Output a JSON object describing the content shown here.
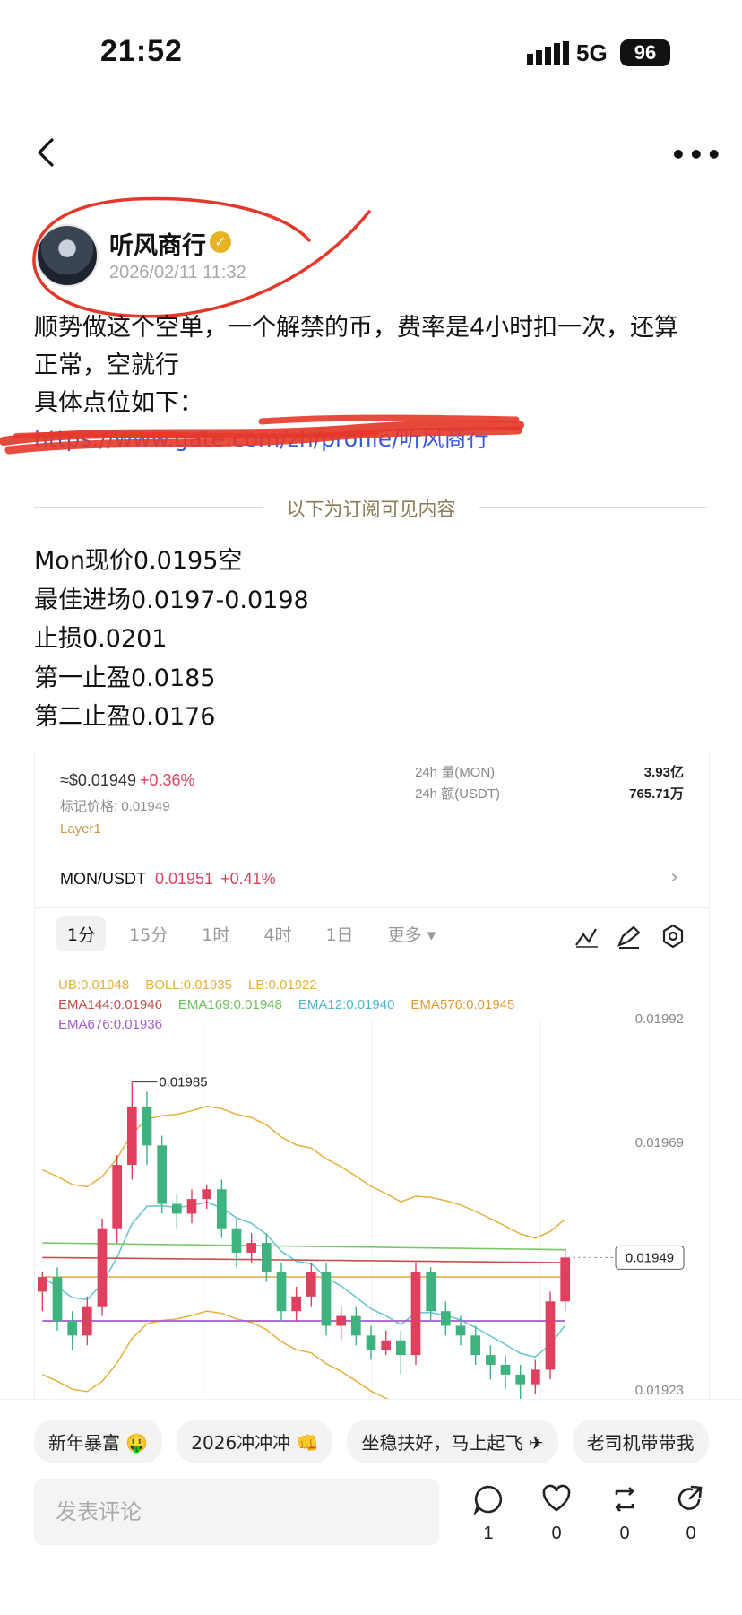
{
  "status_bar": {
    "time": "21:52",
    "network": "5G",
    "battery": "96"
  },
  "post": {
    "author": "听风商行",
    "time": "2026/02/11 11:32",
    "body_lines": [
      "顺势做这个空单，一个解禁的币，费率是4小时扣一次，还算",
      "正常，空就行",
      "具体点位如下："
    ],
    "link": "https://www.gate.com/zh/profile/听风商行",
    "subscriber_divider": "以下为订阅可见内容",
    "plan_lines": [
      "Mon现价0.0195空",
      "最佳进场0.0197-0.0198",
      "止损0.0201",
      "第一止盈0.0185",
      "第二止盈0.0176"
    ]
  },
  "screenshot": {
    "usd_price": "≈$0.01949",
    "usd_change": "+0.36%",
    "mark_price": "标记价格: 0.01949",
    "tag": "Layer1",
    "stats": [
      {
        "label": "24h  量(MON)",
        "value": "3.93亿"
      },
      {
        "label": "24h  额(USDT)",
        "value": "765.71万"
      }
    ],
    "pair": "MON/USDT",
    "pair_price": "0.01951",
    "pair_change": "+0.41%",
    "timeframes": [
      "1分",
      "15分",
      "1时",
      "4时",
      "1日",
      "更多 ▾"
    ],
    "indicators_row1": [
      "UB:0.01948",
      "BOLL:0.01935",
      "LB:0.01922"
    ],
    "indicators_row2": [
      "EMA144:0.01946",
      "EMA169:0.01948",
      "EMA12:0.01940",
      "EMA576:0.01945"
    ],
    "indicators_row3": [
      "EMA676:0.01936"
    ],
    "indicator_colors": [
      "#e7b03a",
      "#e7b03a",
      "#e7b03a",
      "#c0504d",
      "#7ac76a",
      "#6bc6d4",
      "#e09a3a",
      "#a65bd1"
    ],
    "y_labels": [
      "0.01992",
      "0.01969",
      "0.01923"
    ],
    "high_label": "0.01985",
    "current_label": "0.01949"
  },
  "chart_data": {
    "type": "candlestick",
    "ylim": [
      0.0192,
      0.01998
    ],
    "candles": [
      [
        0.01942,
        0.01945,
        0.01938,
        0.01946
      ],
      [
        0.01945,
        0.01936,
        0.01934,
        0.01947
      ],
      [
        0.01936,
        0.01933,
        0.0193,
        0.01938
      ],
      [
        0.01933,
        0.01939,
        0.01931,
        0.01941
      ],
      [
        0.01939,
        0.01955,
        0.01937,
        0.01957
      ],
      [
        0.01955,
        0.01968,
        0.01952,
        0.0197
      ],
      [
        0.01968,
        0.0198,
        0.01965,
        0.01985
      ],
      [
        0.0198,
        0.01972,
        0.01968,
        0.01983
      ],
      [
        0.01972,
        0.0196,
        0.01958,
        0.01974
      ],
      [
        0.0196,
        0.01958,
        0.01955,
        0.01962
      ],
      [
        0.01958,
        0.01961,
        0.01956,
        0.01963
      ],
      [
        0.01961,
        0.01963,
        0.01959,
        0.01964
      ],
      [
        0.01963,
        0.01955,
        0.01953,
        0.01965
      ],
      [
        0.01955,
        0.0195,
        0.01947,
        0.01957
      ],
      [
        0.0195,
        0.01952,
        0.01948,
        0.01954
      ],
      [
        0.01952,
        0.01946,
        0.01944,
        0.01954
      ],
      [
        0.01946,
        0.01938,
        0.01936,
        0.01948
      ],
      [
        0.01938,
        0.01941,
        0.01936,
        0.01943
      ],
      [
        0.01941,
        0.01946,
        0.01939,
        0.01948
      ],
      [
        0.01946,
        0.01935,
        0.01933,
        0.01948
      ],
      [
        0.01935,
        0.01937,
        0.01932,
        0.01939
      ],
      [
        0.01937,
        0.01933,
        0.01931,
        0.01939
      ],
      [
        0.01933,
        0.0193,
        0.01928,
        0.01935
      ],
      [
        0.0193,
        0.01932,
        0.01929,
        0.01934
      ],
      [
        0.01932,
        0.01929,
        0.01925,
        0.01934
      ],
      [
        0.01929,
        0.01946,
        0.01927,
        0.01948
      ],
      [
        0.01946,
        0.01938,
        0.01936,
        0.01947
      ],
      [
        0.01938,
        0.01935,
        0.01933,
        0.0194
      ],
      [
        0.01935,
        0.01933,
        0.01931,
        0.01937
      ],
      [
        0.01933,
        0.01929,
        0.01927,
        0.01935
      ],
      [
        0.01929,
        0.01927,
        0.01924,
        0.01931
      ],
      [
        0.01927,
        0.01925,
        0.01922,
        0.01929
      ],
      [
        0.01925,
        0.01923,
        0.0192,
        0.01927
      ],
      [
        0.01923,
        0.01926,
        0.01921,
        0.01928
      ],
      [
        0.01926,
        0.0194,
        0.01924,
        0.01942
      ],
      [
        0.0194,
        0.01949,
        0.01938,
        0.01951
      ]
    ]
  }
}
